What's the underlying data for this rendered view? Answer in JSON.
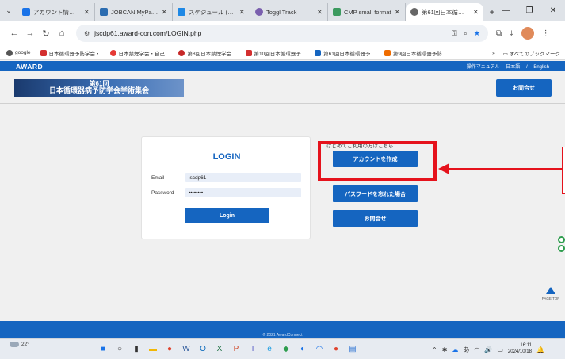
{
  "browser": {
    "tabs": [
      {
        "label": "アカウント情報 | ジョ",
        "favicon_color": "#1a73e8",
        "active": false
      },
      {
        "label": "JOBCAN MyPage",
        "favicon_color": "#2b6cb0",
        "active": false
      },
      {
        "label": "スケジュール (グルー",
        "favicon_color": "#1e88e5",
        "active": false
      },
      {
        "label": "Toggl Track",
        "favicon_color": "#7a5fae",
        "active": false
      },
      {
        "label": "CMP small format",
        "favicon_color": "#3c9a5f",
        "active": false
      },
      {
        "label": "第61回日本循環器",
        "favicon_color": "#666666",
        "active": true
      }
    ],
    "new_tab": "+",
    "url": "jscdp61.award-con.com/LOGIN.php",
    "bookmarks": [
      {
        "label": "google",
        "color": "#555555"
      },
      {
        "label": "日本循環器予防学会・",
        "color": "#d32f2f"
      },
      {
        "label": "日本禁煙学会・自己...",
        "color": "#e53935"
      },
      {
        "label": "第8回日本禁煙学会...",
        "color": "#c62828"
      },
      {
        "label": "第10回日本循環器予...",
        "color": "#d32f2f"
      },
      {
        "label": "第61回日本循環器予...",
        "color": "#1565c0"
      },
      {
        "label": "第9回日本循環器予防...",
        "color": "#ef6c00"
      }
    ],
    "bookmarks_more": "»",
    "all_bookmarks": "すべてのブックマーク"
  },
  "site": {
    "logo": "AWARD",
    "header_links": [
      "操作マニュアル",
      "日本語",
      "/",
      "English"
    ],
    "banner_line1": "第61回",
    "banner_line2": "日本循環器病予防学会学術集会",
    "top_contact": "お問合せ",
    "login": {
      "title": "LOGIN",
      "email_label": "Email",
      "email_value": "jscdp61",
      "password_label": "Password",
      "password_value": "••••••••",
      "login_button": "Login"
    },
    "hint": "はじめてご利用の方はこちら",
    "create_account": "アカウントを作成",
    "forgot_password": "パスワードを忘れた場合",
    "contact": "お問合せ",
    "page_top": "PAGE TOP",
    "footer": "© 2021 AwardConnect"
  },
  "taskbar": {
    "temperature": "22°",
    "time": "16:11",
    "date": "2024/10/18",
    "apps": [
      {
        "icon": "windows-icon",
        "glyph": "■",
        "color": "#1a73e8"
      },
      {
        "icon": "search-icon",
        "glyph": "○",
        "color": "#333333"
      },
      {
        "icon": "task-view-icon",
        "glyph": "▮",
        "color": "#333333"
      },
      {
        "icon": "file-explorer-icon",
        "glyph": "▬",
        "color": "#f2b705"
      },
      {
        "icon": "chrome-icon",
        "glyph": "●",
        "color": "#e0442e"
      },
      {
        "icon": "word-icon",
        "glyph": "W",
        "color": "#2b579a"
      },
      {
        "icon": "outlook-icon",
        "glyph": "O",
        "color": "#0f6cbd"
      },
      {
        "icon": "excel-icon",
        "glyph": "X",
        "color": "#217346"
      },
      {
        "icon": "powerpoint-icon",
        "glyph": "P",
        "color": "#d04423"
      },
      {
        "icon": "teams-icon",
        "glyph": "T",
        "color": "#5b5fc7"
      },
      {
        "icon": "edge-icon",
        "glyph": "e",
        "color": "#1b9de2"
      },
      {
        "icon": "app-icon",
        "glyph": "◆",
        "color": "#2e9d4e"
      },
      {
        "icon": "app2-icon",
        "glyph": "◐",
        "color": "#1a73e8"
      },
      {
        "icon": "wifi-icon",
        "glyph": "◠",
        "color": "#1a73e8"
      },
      {
        "icon": "chrome2-icon",
        "glyph": "●",
        "color": "#e0442e"
      },
      {
        "icon": "notepad-icon",
        "glyph": "▤",
        "color": "#3a7bd5"
      }
    ]
  },
  "colors": {
    "brand": "#1565c0",
    "annotation": "#e5121c"
  }
}
